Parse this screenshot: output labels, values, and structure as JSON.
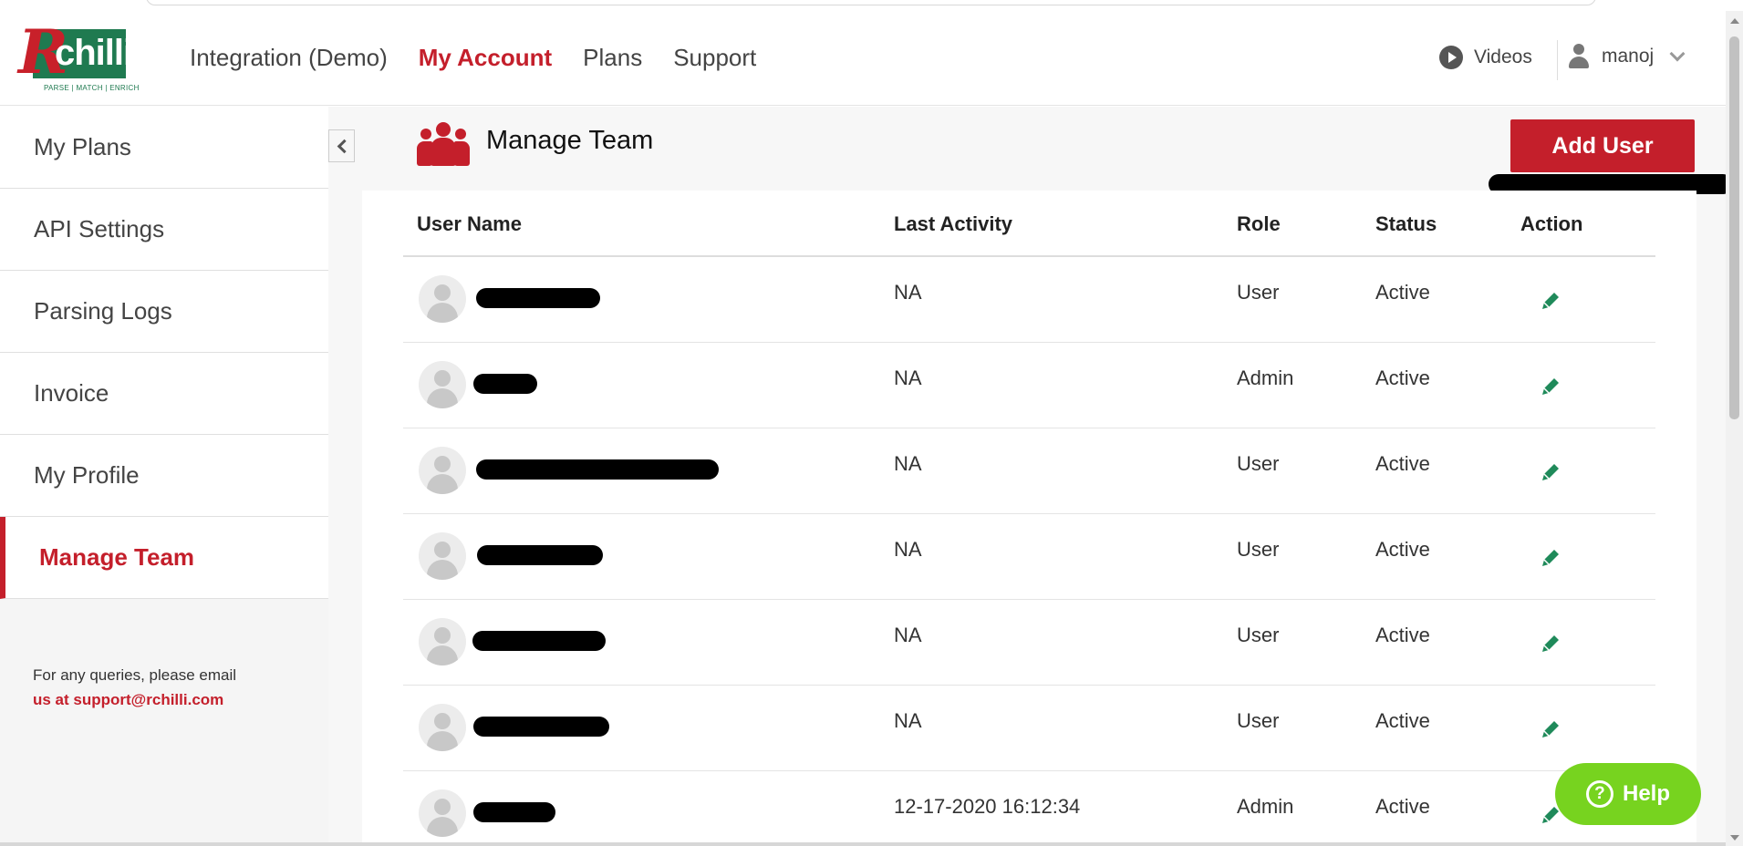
{
  "brand": {
    "logo_r": "R",
    "logo_text": "chilli",
    "tagline": "PARSE | MATCH | ENRICH",
    "accent": "#c41f2b",
    "green": "#1f7a50"
  },
  "nav": {
    "items": [
      "Integration (Demo)",
      "My Account",
      "Plans",
      "Support"
    ],
    "active": "My Account"
  },
  "header": {
    "videos_label": "Videos",
    "username": "manoj"
  },
  "sidebar": {
    "items": [
      "My Plans",
      "API Settings",
      "Parsing Logs",
      "Invoice",
      "My Profile",
      "Manage Team"
    ],
    "active": "Manage Team",
    "queries_line1": "For any queries, please email",
    "queries_line2": "us at support@rchilli.com"
  },
  "page": {
    "title": "Manage Team",
    "add_user_label": "Add User"
  },
  "table": {
    "columns": [
      "User Name",
      "Last Activity",
      "Role",
      "Status",
      "Action"
    ],
    "rows": [
      {
        "last_activity": "NA",
        "role": "User",
        "status": "Active"
      },
      {
        "last_activity": "NA",
        "role": "Admin",
        "status": "Active"
      },
      {
        "last_activity": "NA",
        "role": "User",
        "status": "Active"
      },
      {
        "last_activity": "NA",
        "role": "User",
        "status": "Active"
      },
      {
        "last_activity": "NA",
        "role": "User",
        "status": "Active"
      },
      {
        "last_activity": "NA",
        "role": "User",
        "status": "Active"
      },
      {
        "last_activity": "12-17-2020 16:12:34",
        "role": "Admin",
        "status": "Active"
      }
    ]
  },
  "help": {
    "label": "Help"
  }
}
